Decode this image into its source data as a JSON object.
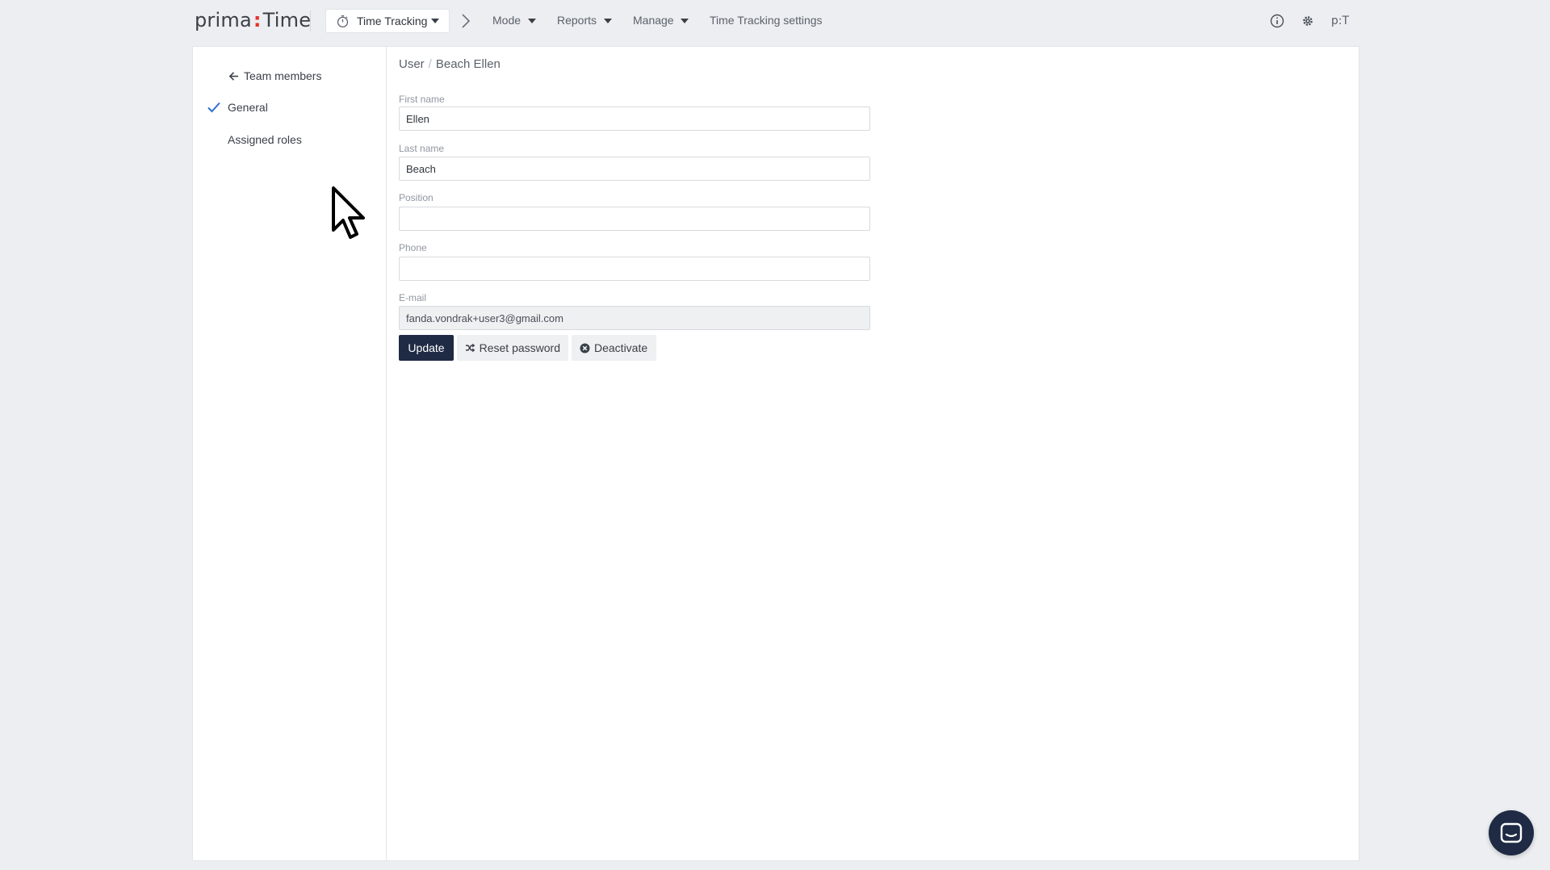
{
  "app": {
    "logo_left": "prima",
    "logo_colon": ":",
    "logo_right": "Time",
    "accent_color": "#e5332a",
    "brand_dark": "#1f2a44"
  },
  "topnav": {
    "module_label": "Time Tracking",
    "module_icon": "stopwatch-icon",
    "items": [
      {
        "label": "Mode",
        "has_dropdown": true
      },
      {
        "label": "Reports",
        "has_dropdown": true
      },
      {
        "label": "Manage",
        "has_dropdown": true
      },
      {
        "label": "Time Tracking settings",
        "has_dropdown": false
      }
    ],
    "user_badge": "p:T"
  },
  "sidebar": {
    "back_label": "Team members",
    "items": [
      {
        "label": "General",
        "active": true
      },
      {
        "label": "Assigned roles",
        "active": false
      }
    ]
  },
  "breadcrumb": {
    "root": "User",
    "separator": "/",
    "current": "Beach Ellen"
  },
  "form": {
    "first_name": {
      "label": "First name",
      "value": "Ellen"
    },
    "last_name": {
      "label": "Last name",
      "value": "Beach"
    },
    "position": {
      "label": "Position",
      "value": ""
    },
    "phone": {
      "label": "Phone",
      "value": ""
    },
    "email": {
      "label": "E-mail",
      "value": "fanda.vondrak+user3@gmail.com"
    }
  },
  "actions": {
    "update_label": "Update",
    "reset_label": "Reset password",
    "deactivate_label": "Deactivate"
  }
}
